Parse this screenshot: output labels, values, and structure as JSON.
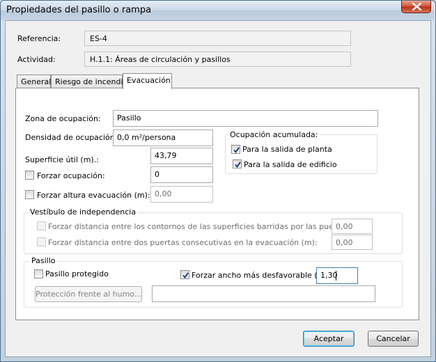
{
  "window": {
    "title": "Propiedades del pasillo o rampa"
  },
  "header": {
    "referencia_label": "Referencia:",
    "referencia_value": "ES-4",
    "actividad_label": "Actividad:",
    "actividad_value": "H.1.1: Áreas de circulación y pasillos"
  },
  "tabs": [
    {
      "label": "General",
      "active": false
    },
    {
      "label": "Riesgo de incendio",
      "active": false
    },
    {
      "label": "Evacuación",
      "active": true
    }
  ],
  "evacuacion": {
    "zona_label": "Zona de ocupación:",
    "zona_value": "Pasillo",
    "densidad_label": "Densidad de ocupación:",
    "densidad_value": "0,0 m²/persona",
    "superficie_label": "Superficie útil (m).:",
    "superficie_value": "43,79",
    "forzar_ocupacion_label": "Forzar ocupación:",
    "forzar_ocupacion_checked": false,
    "forzar_ocupacion_value": "0",
    "forzar_altura_label": "Forzar altura evacuación (m):",
    "forzar_altura_checked": false,
    "forzar_altura_value": "0,00",
    "ocupacion_acumulada": {
      "title": "Ocupación acumulada:",
      "salida_planta_label": "Para la salida de planta",
      "salida_planta_checked": true,
      "salida_edificio_label": "Para la salida de edificio",
      "salida_edificio_checked": true
    },
    "vestibulo": {
      "title": "Vestíbulo de independencia",
      "dist_contornos_label": "Forzar distancia entre los contornos de las superficies barridas por las puertas (m):",
      "dist_contornos_value": "0,00",
      "dist_puertas_label": "Forzar distancia entre dos puertas  consecutivas en la evacuación (m):",
      "dist_puertas_value": "0,00"
    },
    "pasillo": {
      "title": "Pasillo",
      "protegido_label": "Pasillo protegido",
      "protegido_checked": false,
      "forzar_ancho_label": "Forzar ancho más desfavorable (m):",
      "forzar_ancho_checked": true,
      "forzar_ancho_value": "1,30",
      "proteccion_humo_label": "Protección frente al humo...",
      "proteccion_humo_value": ""
    }
  },
  "footer": {
    "aceptar_label": "Aceptar",
    "cancelar_label": "Cancelar"
  },
  "colors": {
    "close_button": "#c8472c",
    "focus_border": "#3c7fb1",
    "panel_bg": "#f0f0f0"
  }
}
